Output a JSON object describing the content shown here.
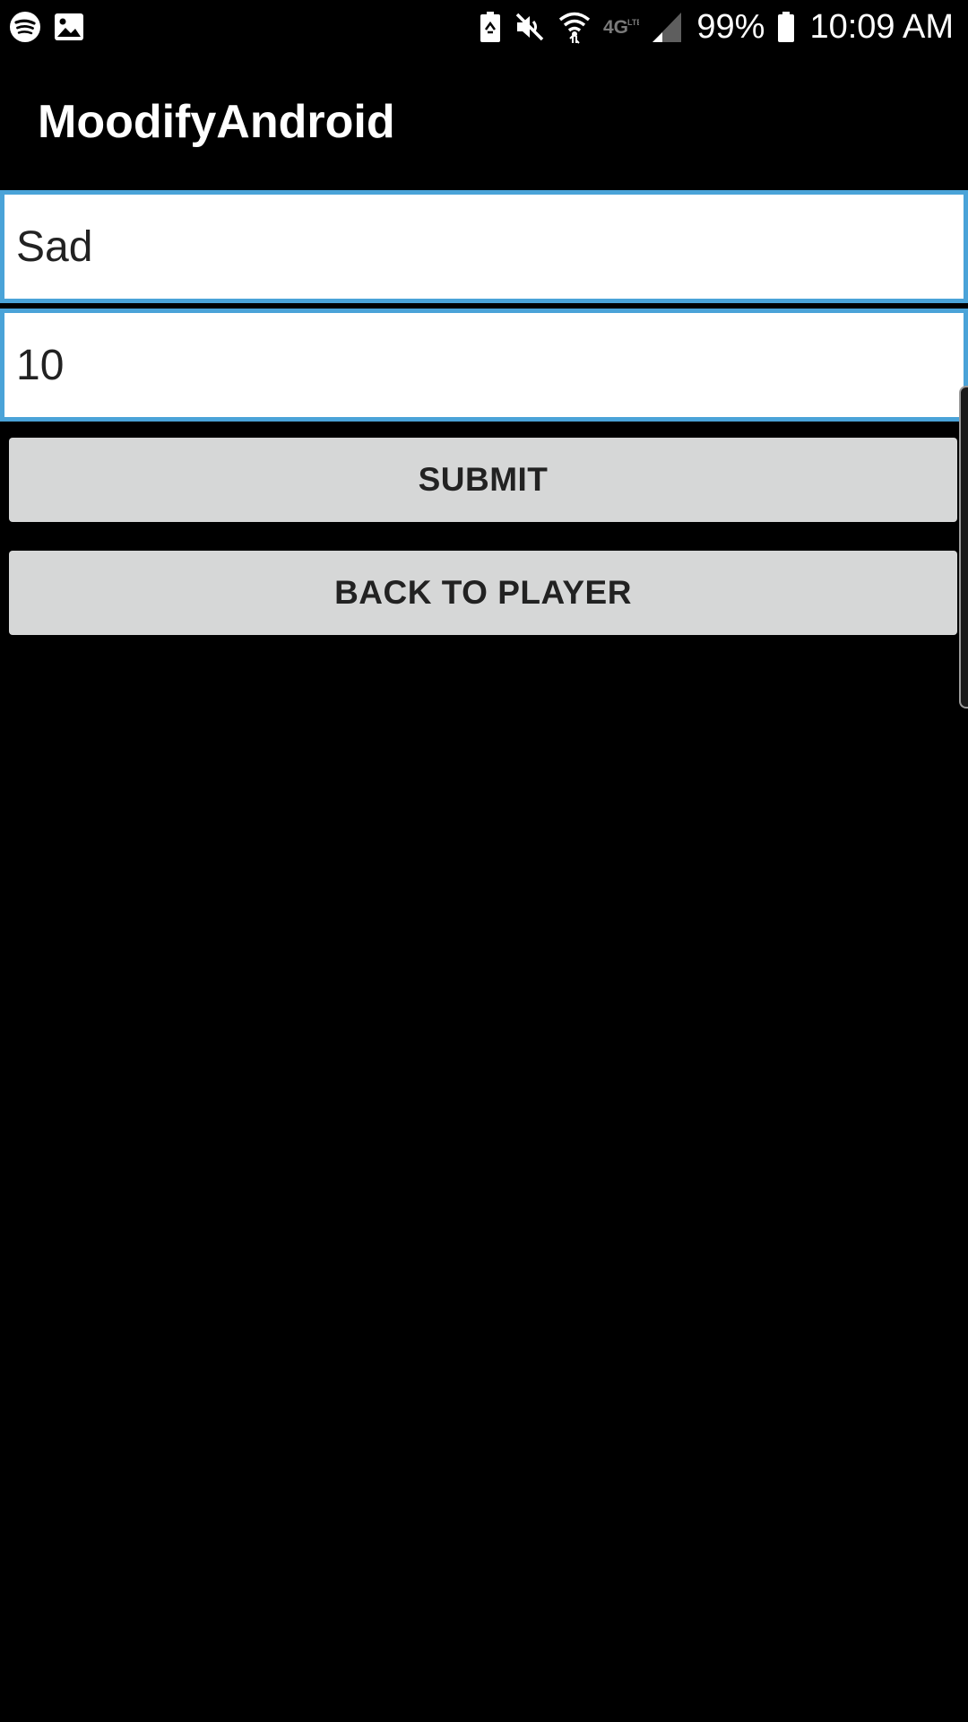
{
  "status_bar": {
    "left_icons": [
      "spotify-icon",
      "image-icon"
    ],
    "right_icons": [
      "battery-saver-icon",
      "mute-icon",
      "wifi-icon",
      "4g-lte-icon",
      "signal-icon",
      "battery-icon"
    ],
    "battery_percent": "99%",
    "time": "10:09 AM"
  },
  "app_bar": {
    "title": "MoodifyAndroid"
  },
  "form": {
    "mood_value": "Sad",
    "intensity_value": "10",
    "submit_label": "SUBMIT",
    "back_label": "BACK TO PLAYER"
  },
  "colors": {
    "background": "#000000",
    "field_border": "#4aa3d8",
    "button_bg": "#d6d7d7",
    "button_text": "#222222",
    "title_text": "#ffffff"
  }
}
